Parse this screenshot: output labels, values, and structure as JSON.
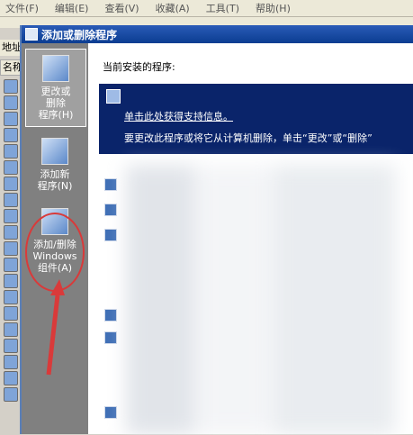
{
  "menu": [
    {
      "label": "文件(F)"
    },
    {
      "label": "编辑(E)"
    },
    {
      "label": "查看(V)"
    },
    {
      "label": "收藏(A)"
    },
    {
      "label": "工具(T)"
    },
    {
      "label": "帮助(H)"
    }
  ],
  "explorer": {
    "address_label": "地址",
    "column_label": "名称"
  },
  "dialog": {
    "title": "添加或删除程序",
    "sidebar": [
      {
        "label": "更改或\n删除\n程序(H)",
        "active": true
      },
      {
        "label": "添加新\n程序(N)",
        "active": false
      },
      {
        "label": "添加/删除\nWindows\n组件(A)",
        "active": false
      }
    ],
    "content": {
      "header": "当前安装的程序:",
      "selected_item": {
        "support_link": "单击此处获得支持信息。",
        "description": "要更改此程序或将它从计算机删除，单击“更改”或“删除”"
      }
    }
  },
  "colors": {
    "titlebar": "#0b3d91",
    "selection": "#0a246a",
    "sidebar": "#808080",
    "annotation": "#d93a3a"
  }
}
